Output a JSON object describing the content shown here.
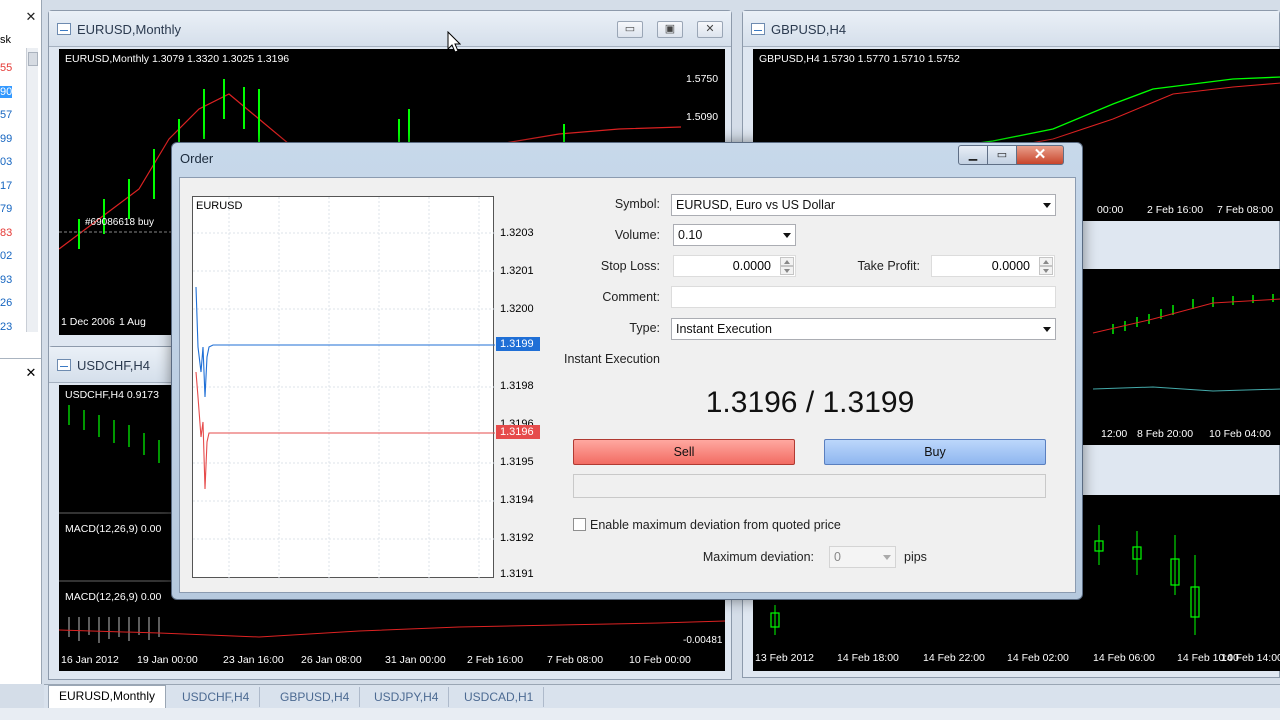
{
  "market_watch": {
    "header": "sk",
    "prices": [
      "55",
      "90",
      "57",
      "99",
      "03",
      "17",
      "79",
      "83",
      "02",
      "93",
      "26",
      "23"
    ],
    "selected_index": 1
  },
  "windows": {
    "eurusd": {
      "title": "EURUSD,Monthly",
      "chart_label": "EURUSD,Monthly  1.3079 1.3320 1.3025 1.3196",
      "order_tag": "#69086618 buy",
      "price_ticks": [
        "1.5750",
        "1.5090"
      ],
      "date_ticks": [
        "1 Dec 2006",
        "1 Aug"
      ]
    },
    "gbpusd": {
      "title": "GBPUSD,H4",
      "chart_label": "GBPUSD,H4  1.5730 1.5770 1.5710 1.5752",
      "date_ticks": [
        "00:00",
        "2 Feb 16:00",
        "7 Feb 08:00"
      ]
    },
    "usdchf": {
      "title": "USDCHF,H4",
      "chart_label": "USDCHF,H4  0.9173",
      "macd_label_1": "MACD(12,26,9) 0.00",
      "macd_label_2": "MACD(12,26,9) 0.00",
      "macd_tick": "-0.00481",
      "date_ticks": [
        "16 Jan 2012",
        "19 Jan 00:00",
        "23 Jan 16:00",
        "26 Jan 08:00",
        "31 Jan 00:00",
        "2 Feb 16:00",
        "7 Feb 08:00",
        "10 Feb 00:00"
      ]
    },
    "right_mid": {
      "date_ticks": [
        "12:00",
        "8 Feb 20:00",
        "10 Feb 04:00"
      ]
    },
    "right_bottom": {
      "date_ticks": [
        "13 Feb 2012",
        "14 Feb 18:00",
        "14 Feb 22:00",
        "14 Feb 02:00",
        "14 Feb 06:00",
        "14 Feb 10:00",
        "14 Feb 14:00"
      ]
    }
  },
  "tabs": [
    {
      "label": "EURUSD,Monthly",
      "active": true
    },
    {
      "label": "USDCHF,H4",
      "active": false
    },
    {
      "label": "GBPUSD,H4",
      "active": false
    },
    {
      "label": "USDJPY,H4",
      "active": false
    },
    {
      "label": "USDCAD,H1",
      "active": false
    }
  ],
  "order_dialog": {
    "title": "Order",
    "close_glyph": "✕",
    "mini_chart": {
      "symbol": "EURUSD",
      "ticks": [
        "1.3203",
        "1.3201",
        "1.3200",
        "1.3198",
        "1.3196",
        "1.3195",
        "1.3194",
        "1.3192",
        "1.3191"
      ],
      "ask": "1.3199",
      "bid": "1.3196"
    },
    "symbol_label": "Symbol:",
    "symbol_value": "EURUSD, Euro vs US Dollar",
    "volume_label": "Volume:",
    "volume_value": "0.10",
    "stop_loss_label": "Stop Loss:",
    "stop_loss_value": "0.0000",
    "take_profit_label": "Take Profit:",
    "take_profit_value": "0.0000",
    "comment_label": "Comment:",
    "comment_value": "",
    "type_label": "Type:",
    "type_value": "Instant Execution",
    "section_label": "Instant Execution",
    "quote": "1.3196 / 1.3199",
    "sell_label": "Sell",
    "buy_label": "Buy",
    "deviation_checkbox_label": "Enable maximum deviation from quoted price",
    "deviation_label": "Maximum deviation:",
    "deviation_value": "0",
    "deviation_unit": "pips"
  },
  "colors": {
    "sell": "#f26c63",
    "buy": "#8fb6ef",
    "ask_line": "#1f6fd6",
    "bid_line": "#e64b4b",
    "candle": "#00ff00"
  }
}
